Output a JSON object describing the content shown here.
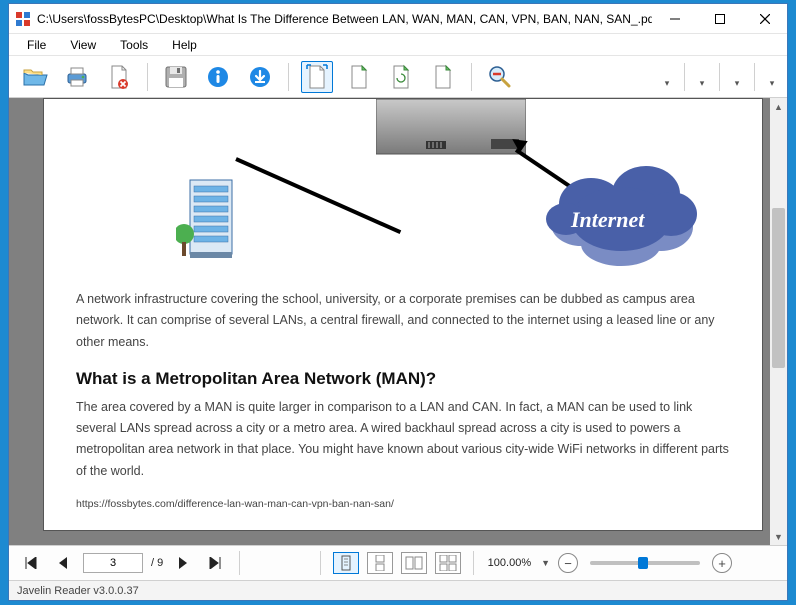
{
  "titlebar": {
    "title": "C:\\Users\\fossBytesPC\\Desktop\\What Is The Difference Between LAN, WAN, MAN, CAN, VPN, BAN, NAN, SAN_.pdf"
  },
  "menu": {
    "file": "File",
    "view": "View",
    "tools": "Tools",
    "help": "Help"
  },
  "toolbar": {
    "open": "open-icon",
    "print": "print-icon",
    "remove_doc": "remove-doc-icon",
    "save": "save-icon",
    "info": "info-icon",
    "download": "download-icon",
    "fit_page": "fit-page-icon",
    "fit_width": "fit-width-icon",
    "rotate_cw": "rotate-cw-icon",
    "rotate_ccw": "rotate-ccw-icon",
    "zoom_out_tool": "zoom-out-tool-icon"
  },
  "document": {
    "illustration_cloud_label": "Internet",
    "para1": "A network infrastructure covering the school, university, or a corporate premises can be dubbed as campus area network. It can comprise of several LANs, a central firewall, and connected to the internet using a leased line or any other means.",
    "heading": "What is a Metropolitan Area Network (MAN)?",
    "para2": "The area covered by a MAN is quite larger in comparison to a LAN and CAN. In fact, a MAN can be used to link several LANs spread across a city or a metro area. A wired backhaul spread across a city is used to powers a metropolitan area network in that place. You might have known about various city-wide WiFi networks in different parts of the world.",
    "url": "https://fossbytes.com/difference-lan-wan-man-can-vpn-ban-nan-san/"
  },
  "nav": {
    "page_current": "3",
    "page_total": "/ 9",
    "zoom": "100.00%"
  },
  "status": {
    "text": "Javelin Reader v3.0.0.37"
  }
}
